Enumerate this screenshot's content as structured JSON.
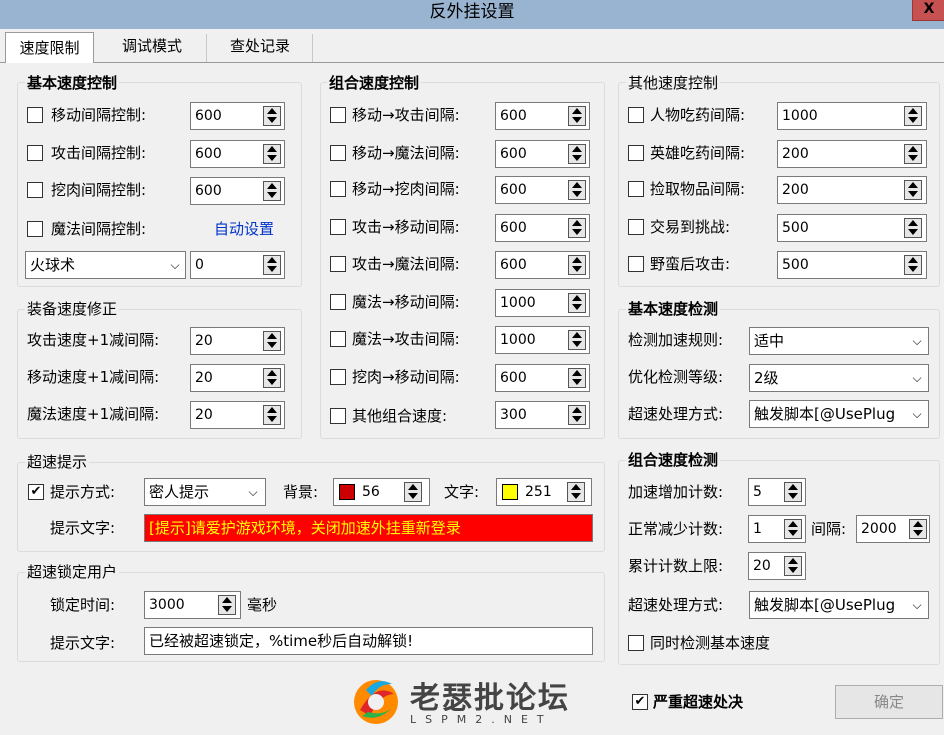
{
  "window": {
    "title": "反外挂设置",
    "close": "X"
  },
  "tabs": [
    "速度限制",
    "调试模式",
    "查处记录"
  ],
  "basic_speed": {
    "title": "基本速度控制",
    "rows": [
      {
        "label": "移动间隔控制:",
        "value": "600"
      },
      {
        "label": "攻击间隔控制:",
        "value": "600"
      },
      {
        "label": "挖肉间隔控制:",
        "value": "600"
      }
    ],
    "magic_label": "魔法间隔控制:",
    "auto_link": "自动设置",
    "spell_select": "火球术",
    "spell_value": "0"
  },
  "equip_speed": {
    "title": "装备速度修正",
    "rows": [
      {
        "label": "攻击速度+1减间隔:",
        "value": "20"
      },
      {
        "label": "移动速度+1减间隔:",
        "value": "20"
      },
      {
        "label": "魔法速度+1减间隔:",
        "value": "20"
      }
    ]
  },
  "combo_speed": {
    "title": "组合速度控制",
    "rows": [
      {
        "label": "移动→攻击间隔:",
        "value": "600"
      },
      {
        "label": "移动→魔法间隔:",
        "value": "600"
      },
      {
        "label": "移动→挖肉间隔:",
        "value": "600"
      },
      {
        "label": "攻击→移动间隔:",
        "value": "600"
      },
      {
        "label": "攻击→魔法间隔:",
        "value": "600"
      },
      {
        "label": "魔法→移动间隔:",
        "value": "1000"
      },
      {
        "label": "魔法→攻击间隔:",
        "value": "1000"
      },
      {
        "label": "挖肉→移动间隔:",
        "value": "600"
      },
      {
        "label": "其他组合速度:",
        "value": "300"
      }
    ]
  },
  "other_speed": {
    "title": "其他速度控制",
    "rows": [
      {
        "label": "人物吃药间隔:",
        "value": "1000"
      },
      {
        "label": "英雄吃药间隔:",
        "value": "200"
      },
      {
        "label": "捡取物品间隔:",
        "value": "200"
      },
      {
        "label": "交易到挑战:",
        "value": "500"
      },
      {
        "label": "野蛮后攻击:",
        "value": "500"
      }
    ]
  },
  "basic_detect": {
    "title": "基本速度检测",
    "rows": [
      {
        "label": "检测加速规则:",
        "value": "适中"
      },
      {
        "label": "优化检测等级:",
        "value": "2级"
      },
      {
        "label": "超速处理方式:",
        "value": "触发脚本[@UsePlug"
      }
    ]
  },
  "combo_detect": {
    "title": "组合速度检测",
    "add_label": "加速增加计数:",
    "add_value": "5",
    "dec_label": "正常减少计数:",
    "dec_value": "1",
    "interval_label": "间隔:",
    "interval_value": "2000",
    "limit_label": "累计计数上限:",
    "limit_value": "20",
    "handle_label": "超速处理方式:",
    "handle_value": "触发脚本[@UsePlug",
    "sync_label": "同时检测基本速度"
  },
  "speed_tip": {
    "title": "超速提示",
    "method_label": "提示方式:",
    "method_value": "密人提示",
    "bg_label": "背景:",
    "bg_value": "56",
    "bg_color": "#cc0000",
    "fg_label": "文字:",
    "fg_value": "251",
    "fg_color": "#ffff00",
    "text_label": "提示文字:",
    "text_value": "[提示]请爱护游戏环境，关闭加速外挂重新登录",
    "text_bg": "#ff0000",
    "text_fg": "#ffff00"
  },
  "speed_lock": {
    "title": "超速锁定用户",
    "time_label": "锁定时间:",
    "time_value": "3000",
    "unit": "毫秒",
    "text_label": "提示文字:",
    "text_value": "已经被超速锁定，%time秒后自动解锁!"
  },
  "strict": {
    "label": "严重超速处决"
  },
  "ok_button": "确定",
  "watermark": {
    "name": "老瑟批论坛",
    "sub": "LSPM2.NET"
  },
  "accent": "#0033cc"
}
